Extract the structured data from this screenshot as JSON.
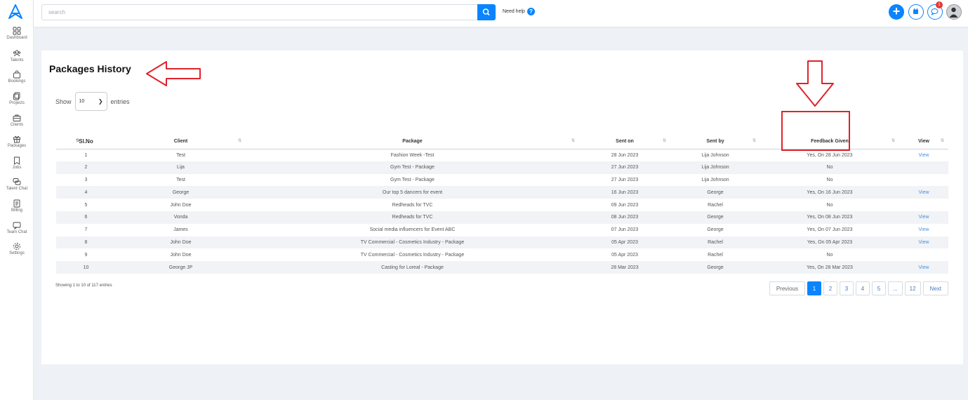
{
  "sidebar": {
    "items": [
      {
        "label": "Dashboard",
        "icon": "grid-icon"
      },
      {
        "label": "Talents",
        "icon": "users-icon"
      },
      {
        "label": "Bookings",
        "icon": "bag-icon"
      },
      {
        "label": "Projects",
        "icon": "copy-icon"
      },
      {
        "label": "Clients",
        "icon": "briefcase-icon"
      },
      {
        "label": "Packages",
        "icon": "gift-icon"
      },
      {
        "label": "Jobs",
        "icon": "bookmark-icon"
      },
      {
        "label": "Talent Chat",
        "icon": "chat-bubbles-icon"
      },
      {
        "label": "Billing",
        "icon": "document-icon"
      },
      {
        "label": "Team Chat",
        "icon": "chat-icon"
      },
      {
        "label": "Settings",
        "icon": "gear-icon"
      }
    ]
  },
  "topbar": {
    "search_placeholder": "search",
    "need_help": "Need help",
    "help_symbol": "?",
    "notification_count": "1",
    "plus_symbol": "+"
  },
  "page": {
    "title": "Packages History",
    "show_label": "Show",
    "entries_value": "10",
    "entries_label": "entries",
    "showing_info": "Showing 1 to 10 of 117 entries"
  },
  "table": {
    "columns": [
      "Sl.No",
      "Client",
      "Package",
      "Sent on",
      "Sent by",
      "Feedback Given",
      "View"
    ],
    "rows": [
      {
        "no": "1",
        "client": "Test",
        "package": "Fashion Week -Test",
        "sent_on": "28 Jun 2023",
        "sent_by": "Lija Johnson",
        "feedback": "Yes, On 28 Jun 2023",
        "view": "View"
      },
      {
        "no": "2",
        "client": "Lija",
        "package": "Gym Test - Package",
        "sent_on": "27 Jun 2023",
        "sent_by": "Lija Johnson",
        "feedback": "No",
        "view": ""
      },
      {
        "no": "3",
        "client": "Test",
        "package": "Gym Test - Package",
        "sent_on": "27 Jun 2023",
        "sent_by": "Lija Johnson",
        "feedback": "No",
        "view": ""
      },
      {
        "no": "4",
        "client": "George",
        "package": "Our top 5 dancers for event",
        "sent_on": "16 Jun 2023",
        "sent_by": "George",
        "feedback": "Yes, On 16 Jun 2023",
        "view": "View"
      },
      {
        "no": "5",
        "client": "John Doe",
        "package": "Redheads for TVC",
        "sent_on": "09 Jun 2023",
        "sent_by": "Rachel",
        "feedback": "No",
        "view": ""
      },
      {
        "no": "6",
        "client": "Vonda",
        "package": "Redheads for TVC",
        "sent_on": "08 Jun 2023",
        "sent_by": "George",
        "feedback": "Yes, On 08 Jun 2023",
        "view": "View"
      },
      {
        "no": "7",
        "client": "James",
        "package": "Social media influencers for Event ABC",
        "sent_on": "07 Jun 2023",
        "sent_by": "George",
        "feedback": "Yes, On 07 Jun 2023",
        "view": "View"
      },
      {
        "no": "8",
        "client": "John Doe",
        "package": "TV Commercial - Cosmetics Industry - Package",
        "sent_on": "05 Apr 2023",
        "sent_by": "Rachel",
        "feedback": "Yes, On 05 Apr 2023",
        "view": "View"
      },
      {
        "no": "9",
        "client": "John Doe",
        "package": "TV Commercial - Cosmetics Industry - Package",
        "sent_on": "05 Apr 2023",
        "sent_by": "Rachel",
        "feedback": "No",
        "view": ""
      },
      {
        "no": "10",
        "client": "George JP",
        "package": "Casting for Loreal - Package",
        "sent_on": "28 Mar 2023",
        "sent_by": "George",
        "feedback": "Yes, On 28 Mar 2023",
        "view": "View"
      }
    ]
  },
  "pagination": {
    "previous": "Previous",
    "pages": [
      "1",
      "2",
      "3",
      "4",
      "5",
      "...",
      "12"
    ],
    "active_page": "1",
    "next": "Next"
  },
  "colors": {
    "accent": "#0a84ff",
    "annotation_red": "#e0222a",
    "link": "#4a90d9"
  }
}
